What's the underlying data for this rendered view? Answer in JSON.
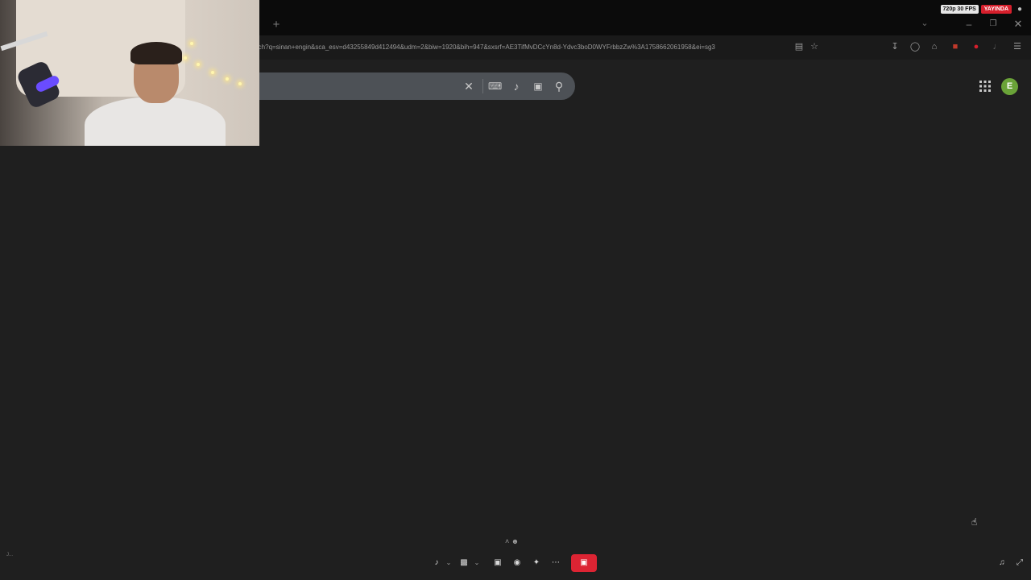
{
  "browser": {
    "url": "rch?q=sinan+engin&sca_esv=d43255849d412494&udm=2&biw=1920&bih=947&sxsrf=AE3TifMvDCcYn8d-Ydvc3boD0WYFrbbzZw%3A1758662061958&ei=sg3"
  },
  "stream": {
    "fps_label": "720p 30 FPS",
    "live_label": "YAYINDA"
  },
  "account": {
    "avatar_initial": "E"
  },
  "colors": {
    "live_red": "#d61f2c",
    "avatar_green": "#6aa338",
    "page_bg": "#1f1f1f",
    "search_bg": "#4d5156"
  },
  "bottom": {
    "corner_label": "J..."
  }
}
